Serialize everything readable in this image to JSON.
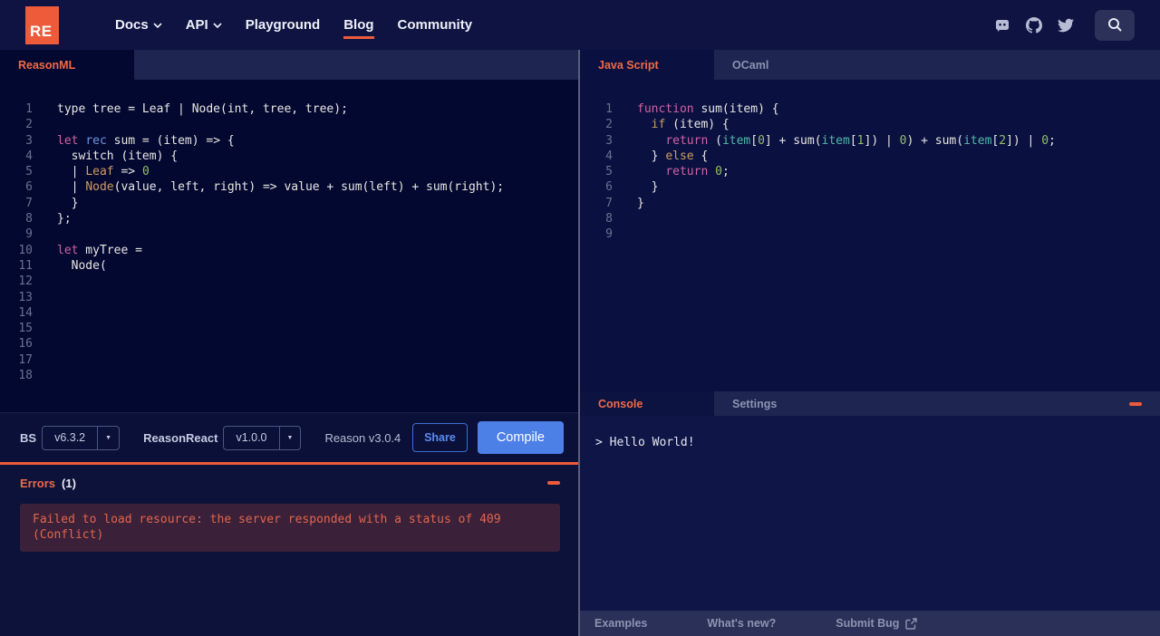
{
  "nav": {
    "logo_text": "RE",
    "items": [
      {
        "label": "Docs",
        "has_chevron": true,
        "active": false
      },
      {
        "label": "API",
        "has_chevron": true,
        "active": false
      },
      {
        "label": "Playground",
        "has_chevron": false,
        "active": false
      },
      {
        "label": "Blog",
        "has_chevron": false,
        "active": true
      },
      {
        "label": "Community",
        "has_chevron": false,
        "active": false
      }
    ]
  },
  "left_panel": {
    "tab_label": "ReasonML",
    "editor": {
      "gutter_count": 18,
      "lines": [
        [
          [
            "p",
            "type tree = Leaf | Node(int, tree, tree);"
          ]
        ],
        [],
        [
          [
            "k",
            "let"
          ],
          [
            "p",
            " "
          ],
          [
            "b",
            "rec"
          ],
          [
            "p",
            " sum = (item) => {"
          ]
        ],
        [
          [
            "p",
            "  switch (item) {"
          ]
        ],
        [
          [
            "p",
            "  | "
          ],
          [
            "o",
            "Leaf"
          ],
          [
            "p",
            " => "
          ],
          [
            "n",
            "0"
          ]
        ],
        [
          [
            "p",
            "  | "
          ],
          [
            "o",
            "Node"
          ],
          [
            "p",
            "(value, left, right) => value + sum(left) + sum(right);"
          ]
        ],
        [
          [
            "p",
            "  }"
          ]
        ],
        [
          [
            "p",
            "};"
          ]
        ],
        [],
        [
          [
            "k",
            "let"
          ],
          [
            "p",
            " myTree ="
          ]
        ],
        [
          [
            "p",
            "  Node("
          ]
        ]
      ]
    },
    "toolbar": {
      "bs_label": "BS",
      "bs_version": "v6.3.2",
      "reasonreact_label": "ReasonReact",
      "reasonreact_version": "v1.0.0",
      "reason_version_text": "Reason v3.0.4",
      "share_label": "Share",
      "compile_label": "Compile"
    },
    "errors": {
      "title": "Errors",
      "count": "(1)",
      "message_lines": [
        "Failed to load resource: the server responded with a status of 409",
        "(Conflict)"
      ]
    }
  },
  "right_panel": {
    "tabs": [
      {
        "label": "Java Script",
        "active": true
      },
      {
        "label": "OCaml",
        "active": false
      }
    ],
    "editor": {
      "gutter_count": 9,
      "lines": [
        [
          [
            "k",
            "function"
          ],
          [
            "p",
            " sum(item) {"
          ]
        ],
        [
          [
            "p",
            "  "
          ],
          [
            "o",
            "if"
          ],
          [
            "p",
            " (item) {"
          ]
        ],
        [
          [
            "p",
            "    "
          ],
          [
            "k",
            "return"
          ],
          [
            "p",
            " ("
          ],
          [
            "t",
            "item"
          ],
          [
            "p",
            "["
          ],
          [
            "n",
            "0"
          ],
          [
            "p",
            "] + sum("
          ],
          [
            "t",
            "item"
          ],
          [
            "p",
            "["
          ],
          [
            "n",
            "1"
          ],
          [
            "p",
            "]) | "
          ],
          [
            "n",
            "0"
          ],
          [
            "p",
            ") + sum("
          ],
          [
            "t",
            "item"
          ],
          [
            "p",
            "["
          ],
          [
            "n",
            "2"
          ],
          [
            "p",
            "]) | "
          ],
          [
            "n",
            "0"
          ],
          [
            "p",
            ";"
          ]
        ],
        [
          [
            "p",
            "  } "
          ],
          [
            "o",
            "else"
          ],
          [
            "p",
            " {"
          ]
        ],
        [
          [
            "p",
            "    "
          ],
          [
            "k",
            "return"
          ],
          [
            "p",
            " "
          ],
          [
            "n",
            "0"
          ],
          [
            "p",
            ";"
          ]
        ],
        [
          [
            "p",
            "  }"
          ]
        ],
        [
          [
            "p",
            "}"
          ]
        ]
      ]
    },
    "console": {
      "tabs": [
        {
          "label": "Console",
          "active": true
        },
        {
          "label": "Settings",
          "active": false
        }
      ],
      "output": "> Hello World!"
    },
    "footer_links": [
      "Examples",
      "What's new?",
      "Submit Bug"
    ]
  },
  "colors": {
    "accent_orange": "#ed5b3b",
    "accent_orange_text": "#f06a48",
    "button_blue": "#4d80e6",
    "error_text": "#e2654a",
    "error_bg": "#3a2139"
  }
}
